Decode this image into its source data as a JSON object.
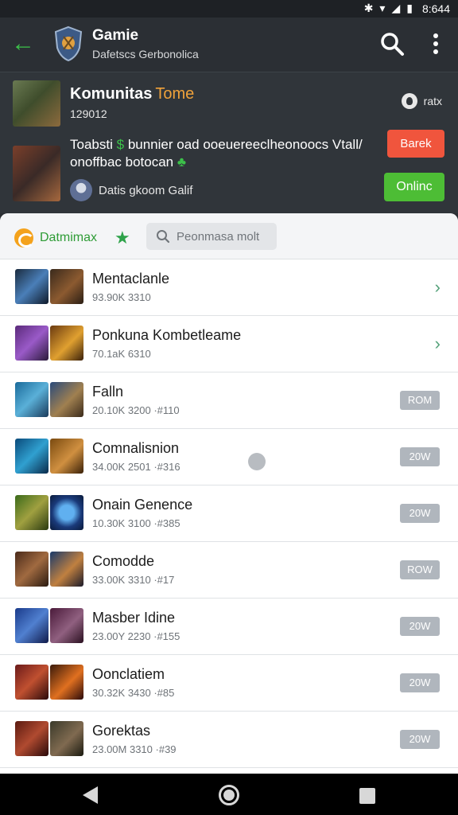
{
  "status_bar": {
    "time": "8:644"
  },
  "app_bar": {
    "title": "Gamie",
    "subtitle": "Dafetscs Gerbonolica",
    "back_icon": "arrow-left-icon",
    "search_icon": "search-icon",
    "more_icon": "more-vertical-icon"
  },
  "community": {
    "title": "Komunitas",
    "tag": "Tome",
    "code": "129012",
    "rate_label": "ratx",
    "description_line1": "Toabsti",
    "description_mid": "bunnier oad ooeuereeclheonoocs Vtall/",
    "description_line2": "onoffbac botocan",
    "badge_text": "Datis gkoom Galif",
    "report_label": "Barek",
    "online_label": "Onlinc"
  },
  "filter": {
    "chip_label": "Datmimax",
    "search_placeholder": "Peonmasa molt"
  },
  "items": [
    {
      "title": "Mentaclanle",
      "meta": "93.90K  3310",
      "action": "chevron"
    },
    {
      "title": "Ponkuna Kombetleame",
      "meta": "70.1aK  6310",
      "action": "chevron"
    },
    {
      "title": "Falln",
      "meta": "20.10K  3200  ·#110",
      "action": "pill",
      "pill": "ROM"
    },
    {
      "title": "Comnalisnion",
      "meta": "34.00K  2501  ·#316",
      "action": "pill",
      "pill": "20W"
    },
    {
      "title": "Onain Genence",
      "meta": "10.30K  3100  ·#385",
      "action": "pill",
      "pill": "20W"
    },
    {
      "title": "Comodde",
      "meta": "33.00K  3310  ·#17",
      "action": "pill",
      "pill": "ROW"
    },
    {
      "title": "Masber Idine",
      "meta": "23.00Y  2230  ·#155",
      "action": "pill",
      "pill": "20W"
    },
    {
      "title": "Oonclatiem",
      "meta": "30.32K  3430  ·#85",
      "action": "pill",
      "pill": "20W"
    },
    {
      "title": "Gorektas",
      "meta": "23.00M  3310  ·#39",
      "action": "pill",
      "pill": "20W"
    }
  ],
  "colors": {
    "accent_green": "#3cc14a",
    "report_red": "#f0553d",
    "online_green": "#4dbd35"
  }
}
